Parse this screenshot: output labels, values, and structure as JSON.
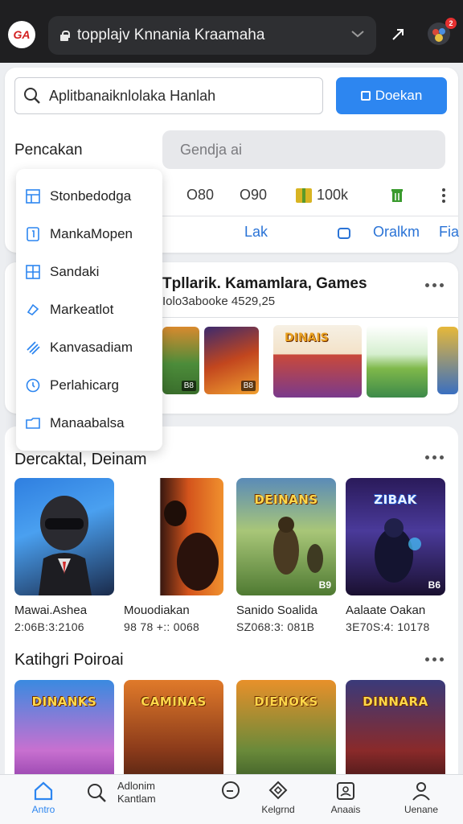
{
  "browser": {
    "logo_text": "GA",
    "url": "topplajv Knnania Kraamaha",
    "notification_count": "2"
  },
  "search": {
    "value": "Aplitbanaiknlolaka Hanlah",
    "button_label": "Doekan"
  },
  "filters": {
    "section_label": "Pencakan",
    "field_placeholder": "Gendja ai",
    "stats": [
      "O80",
      "O90",
      "100k"
    ],
    "tabs": [
      "Lak",
      "Oralkm",
      "Fia"
    ]
  },
  "dropdown": {
    "items": [
      {
        "label": "Stonbedodga",
        "icon": "grid-icon"
      },
      {
        "label": "MankaMopen",
        "icon": "document-icon"
      },
      {
        "label": "Sandaki",
        "icon": "table-icon"
      },
      {
        "label": "Markeatlot",
        "icon": "chat-icon"
      },
      {
        "label": "Kanvasadiam",
        "icon": "stripes-icon"
      },
      {
        "label": "Perlahicarg",
        "icon": "clock-icon"
      },
      {
        "label": "Manaabalsa",
        "icon": "folder-icon"
      }
    ]
  },
  "featured": {
    "title": "Tpllarik. Kamamlara, Games",
    "subtitle": "Iolo3abooke 4529,25"
  },
  "sections": [
    {
      "title": "Dercaktal, Deinam",
      "games": [
        {
          "name": "Mawai.Ashea",
          "meta": "2:06B:3:2106",
          "cover_title": "",
          "badge": ""
        },
        {
          "name": "Mouodiakan",
          "meta": "98 78 +:: 0068",
          "cover_title": "",
          "badge": ""
        },
        {
          "name": "Sanido Soalida",
          "meta": "SZ068:3: 081B",
          "cover_title": "DEINANS",
          "badge": "B9"
        },
        {
          "name": "Aalaate Oakan",
          "meta": "3E70S:4: 10178",
          "cover_title": "ZIBAK",
          "badge": "B6"
        }
      ]
    },
    {
      "title": "Katihgri Poiroai",
      "games": [
        {
          "cover_title": "DINANKS"
        },
        {
          "cover_title": "CAMINAS"
        },
        {
          "cover_title": "DIENOKS"
        },
        {
          "cover_title": "DINNARA"
        }
      ]
    }
  ],
  "bottom_nav": [
    {
      "label": "Antro",
      "icon": "home-icon",
      "active": true
    },
    {
      "label": "Adlonim Kantlam",
      "icon": "search-icon",
      "active": false
    },
    {
      "label": "",
      "icon": "zoom-out-icon",
      "active": false
    },
    {
      "label": "Kelgrnd",
      "icon": "shapes-icon",
      "active": false
    },
    {
      "label": "Anaais",
      "icon": "id-card-icon",
      "active": false
    },
    {
      "label": "Uenane",
      "icon": "user-icon",
      "active": false
    }
  ],
  "colors": {
    "accent": "#2d86f0",
    "top_bar": "#1f1f21"
  }
}
